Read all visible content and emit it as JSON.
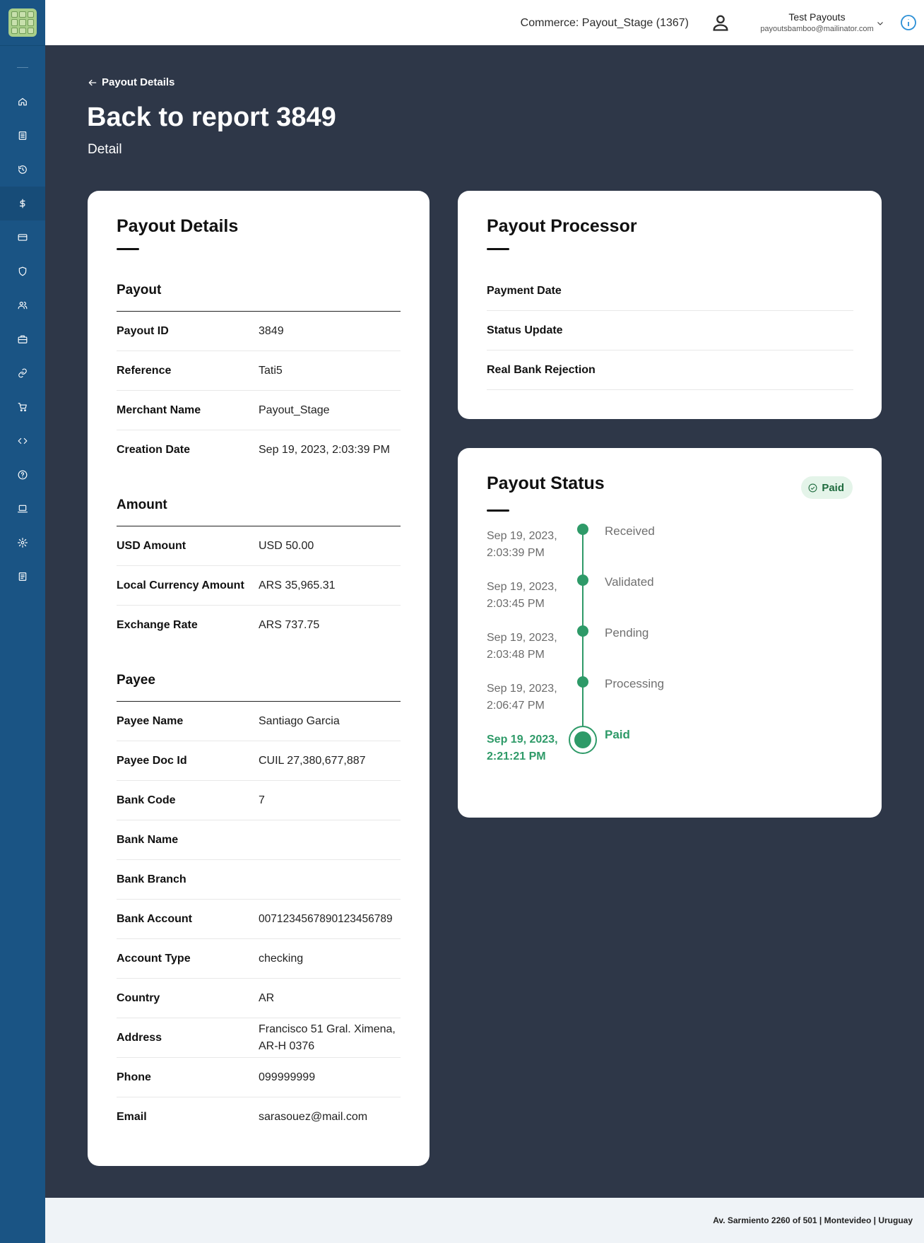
{
  "topbar": {
    "commerce": "Commerce: Payout_Stage (1367)",
    "user_name": "Test Payouts",
    "user_email": "payoutsbamboo@mailinator.com"
  },
  "sidebar": {
    "items": [
      "home-icon",
      "list-icon",
      "history-icon",
      "dollar-icon",
      "card-icon",
      "shield-icon",
      "users-icon",
      "briefcase-icon",
      "link-icon",
      "cart-icon",
      "code-icon",
      "help-icon",
      "laptop-icon",
      "gear-icon",
      "report-icon"
    ],
    "active": "dollar-icon"
  },
  "header": {
    "breadcrumb": "Payout Details",
    "title": "Back to report 3849",
    "subtitle": "Detail"
  },
  "details": {
    "title": "Payout Details",
    "payout": {
      "title": "Payout",
      "rows": [
        {
          "label": "Payout ID",
          "value": "3849"
        },
        {
          "label": "Reference",
          "value": "Tati5"
        },
        {
          "label": "Merchant Name",
          "value": "Payout_Stage"
        },
        {
          "label": "Creation Date",
          "value": "Sep 19, 2023, 2:03:39 PM"
        }
      ]
    },
    "amount": {
      "title": "Amount",
      "rows": [
        {
          "label": "USD Amount",
          "value": "USD 50.00"
        },
        {
          "label": "Local Currency Amount",
          "value": "ARS 35,965.31"
        },
        {
          "label": "Exchange Rate",
          "value": "ARS 737.75"
        }
      ]
    },
    "payee": {
      "title": "Payee",
      "rows": [
        {
          "label": "Payee Name",
          "value": "Santiago Garcia"
        },
        {
          "label": "Payee Doc Id",
          "value": "CUIL 27,380,677,887"
        },
        {
          "label": "Bank Code",
          "value": "7"
        },
        {
          "label": "Bank Name",
          "value": ""
        },
        {
          "label": "Bank Branch",
          "value": ""
        },
        {
          "label": "Bank Account",
          "value": "0071234567890123456789"
        },
        {
          "label": "Account Type",
          "value": "checking"
        },
        {
          "label": "Country",
          "value": "AR"
        },
        {
          "label": "Address",
          "value": "Francisco 51 Gral. Ximena, AR-H 0376"
        },
        {
          "label": "Phone",
          "value": "099999999"
        },
        {
          "label": "Email",
          "value": "sarasouez@mail.com"
        }
      ]
    }
  },
  "processor": {
    "title": "Payout Processor",
    "rows": [
      "Payment Date",
      "Status Update",
      "Real Bank Rejection"
    ]
  },
  "status": {
    "title": "Payout Status",
    "badge": "Paid",
    "accent": "#2e9a68",
    "steps": [
      {
        "date1": "Sep 19, 2023,",
        "date2": "2:03:39 PM",
        "label": "Received"
      },
      {
        "date1": "Sep 19, 2023,",
        "date2": "2:03:45 PM",
        "label": "Validated"
      },
      {
        "date1": "Sep 19, 2023,",
        "date2": "2:03:48 PM",
        "label": "Pending"
      },
      {
        "date1": "Sep 19, 2023,",
        "date2": "2:06:47 PM",
        "label": "Processing"
      },
      {
        "date1": "Sep 19, 2023,",
        "date2": "2:21:21 PM",
        "label": "Paid"
      }
    ]
  },
  "footer": {
    "address": "Av. Sarmiento 2260 of 501 | Montevideo | Uruguay"
  }
}
